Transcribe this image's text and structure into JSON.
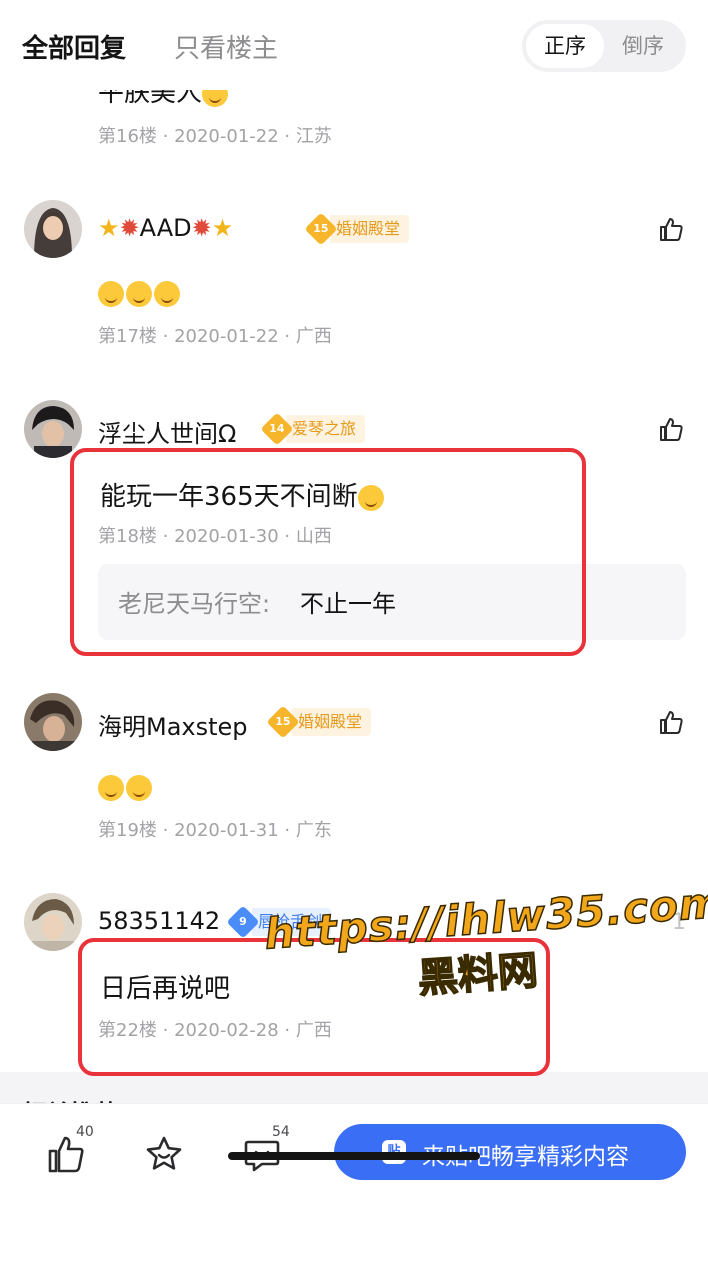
{
  "tabs": {
    "all": "全部回复",
    "op_only": "只看楼主"
  },
  "order": {
    "asc": "正序",
    "desc": "倒序"
  },
  "previous_comment": {
    "text": "平朕美人",
    "meta": "第16楼 · 2020-01-22 · 江苏"
  },
  "comments": [
    {
      "username": "AAD",
      "badge": {
        "level": "15",
        "title": "婚姻殿堂",
        "color": "gold"
      },
      "body": "",
      "emoji_count": 3,
      "meta": "第17楼 · 2020-01-22 · 广西"
    },
    {
      "username": "浮尘人世间Ω",
      "badge": {
        "level": "14",
        "title": "爱琴之旅",
        "color": "gold"
      },
      "body": "能玩一年365天不间断",
      "meta": "第18楼 · 2020-01-30 · 山西",
      "reply": {
        "author": "老尼天马行空:",
        "text": "不止一年"
      }
    },
    {
      "username": "海明Maxstep",
      "badge": {
        "level": "15",
        "title": "婚姻殿堂",
        "color": "gold"
      },
      "body": "",
      "emoji_count": 2,
      "meta": "第19楼 · 2020-01-31 · 广东"
    },
    {
      "username": "58351142",
      "badge": {
        "level": "9",
        "title": "唇枪舌剑",
        "color": "blue"
      },
      "body": "日后再说吧",
      "meta": "第22楼 · 2020-02-28 · 广西"
    }
  ],
  "watermark": {
    "url": "https://ihlw35.com",
    "name": "黑料网"
  },
  "section_peek": "相关推荐",
  "bottom_bar": {
    "like_count": "40",
    "comment_count": "54",
    "cta_icon": "贴",
    "cta_label": "来贴吧畅享精彩内容"
  },
  "colors": {
    "accent": "#3a6ff5",
    "highlight_frame": "#e8333a",
    "badge_gold": "#f7b52c",
    "badge_blue": "#4a8df8"
  }
}
